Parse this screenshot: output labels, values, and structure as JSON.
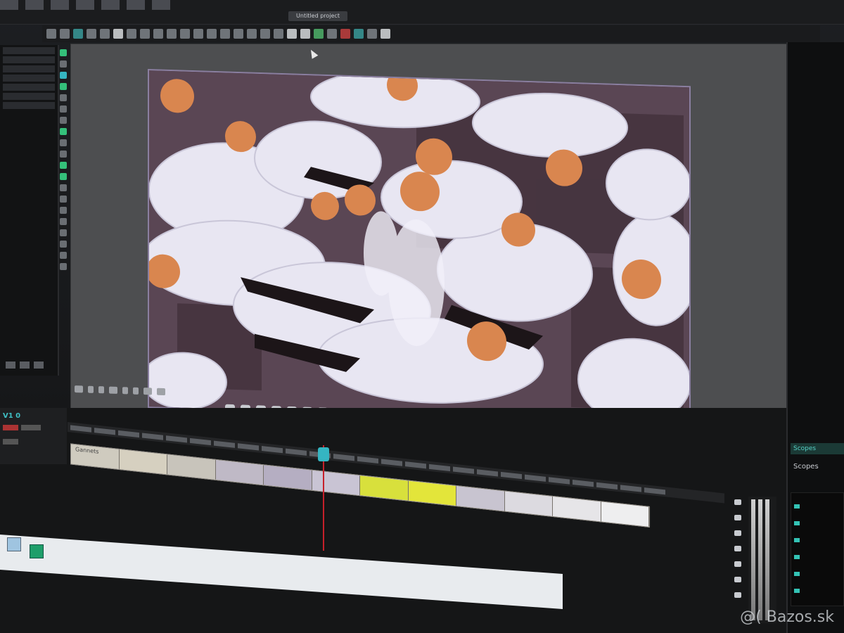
{
  "app": {
    "project_title": "Untitled project"
  },
  "toolbar": {
    "icons": [
      "cut-icon",
      "select-icon",
      "trim-icon",
      "slip-icon",
      "slide-icon",
      "transform-icon",
      "crop-icon",
      "text-icon",
      "color-icon",
      "effects-icon",
      "marker-icon",
      "link-icon",
      "record-icon",
      "render-icon",
      "settings-icon"
    ]
  },
  "viewer": {
    "content": "video-frame-gannets"
  },
  "timeline": {
    "header_label": "V1 0",
    "clip_label": "Gannets"
  },
  "scopes": {
    "tab_label": "Scopes",
    "panel_label": "Scopes"
  },
  "watermark": "@( Bazos.sk"
}
